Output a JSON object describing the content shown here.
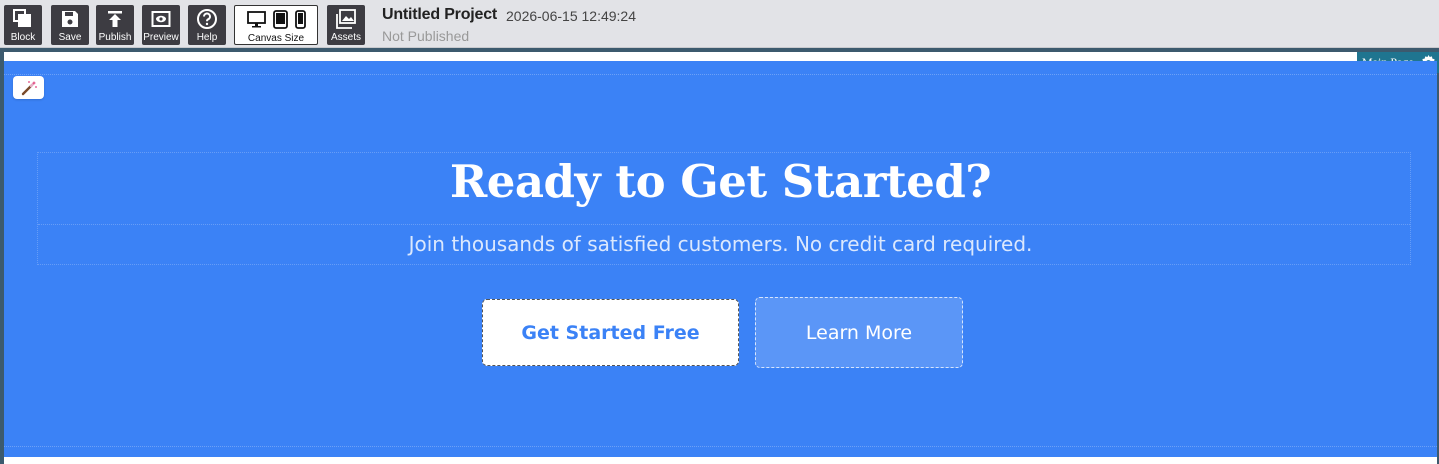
{
  "toolbar": {
    "buttons": [
      {
        "label": "Block",
        "icon": "block-icon"
      },
      {
        "label": "Save",
        "icon": "save-icon"
      },
      {
        "label": "Publish",
        "icon": "publish-icon"
      },
      {
        "label": "Preview",
        "icon": "preview-icon"
      },
      {
        "label": "Help",
        "icon": "help-icon"
      }
    ],
    "canvas_size": {
      "label": "Canvas Size",
      "devices": [
        "desktop-icon",
        "tablet-icon",
        "mobile-icon"
      ]
    },
    "assets": {
      "label": "Assets",
      "icon": "assets-icon"
    }
  },
  "project": {
    "title": "Untitled Project",
    "timestamp": "2026-06-15 12:49:24",
    "status": "Not Published"
  },
  "page_tab": {
    "label": "Main Page",
    "icon": "gear-icon"
  },
  "hero": {
    "background": "#3b82f6",
    "headline": "Ready to Get Started?",
    "subheadline": "Join thousands of satisfied customers. No credit card required.",
    "primary_button": "Get Started Free",
    "secondary_button": "Learn More"
  },
  "colors": {
    "toolbar_bg": "#e2e3e7",
    "button_bg": "#3d3c42",
    "frame": "#3c5a6e",
    "page_tab": "#1f7590",
    "accent": "#3b82f6"
  }
}
